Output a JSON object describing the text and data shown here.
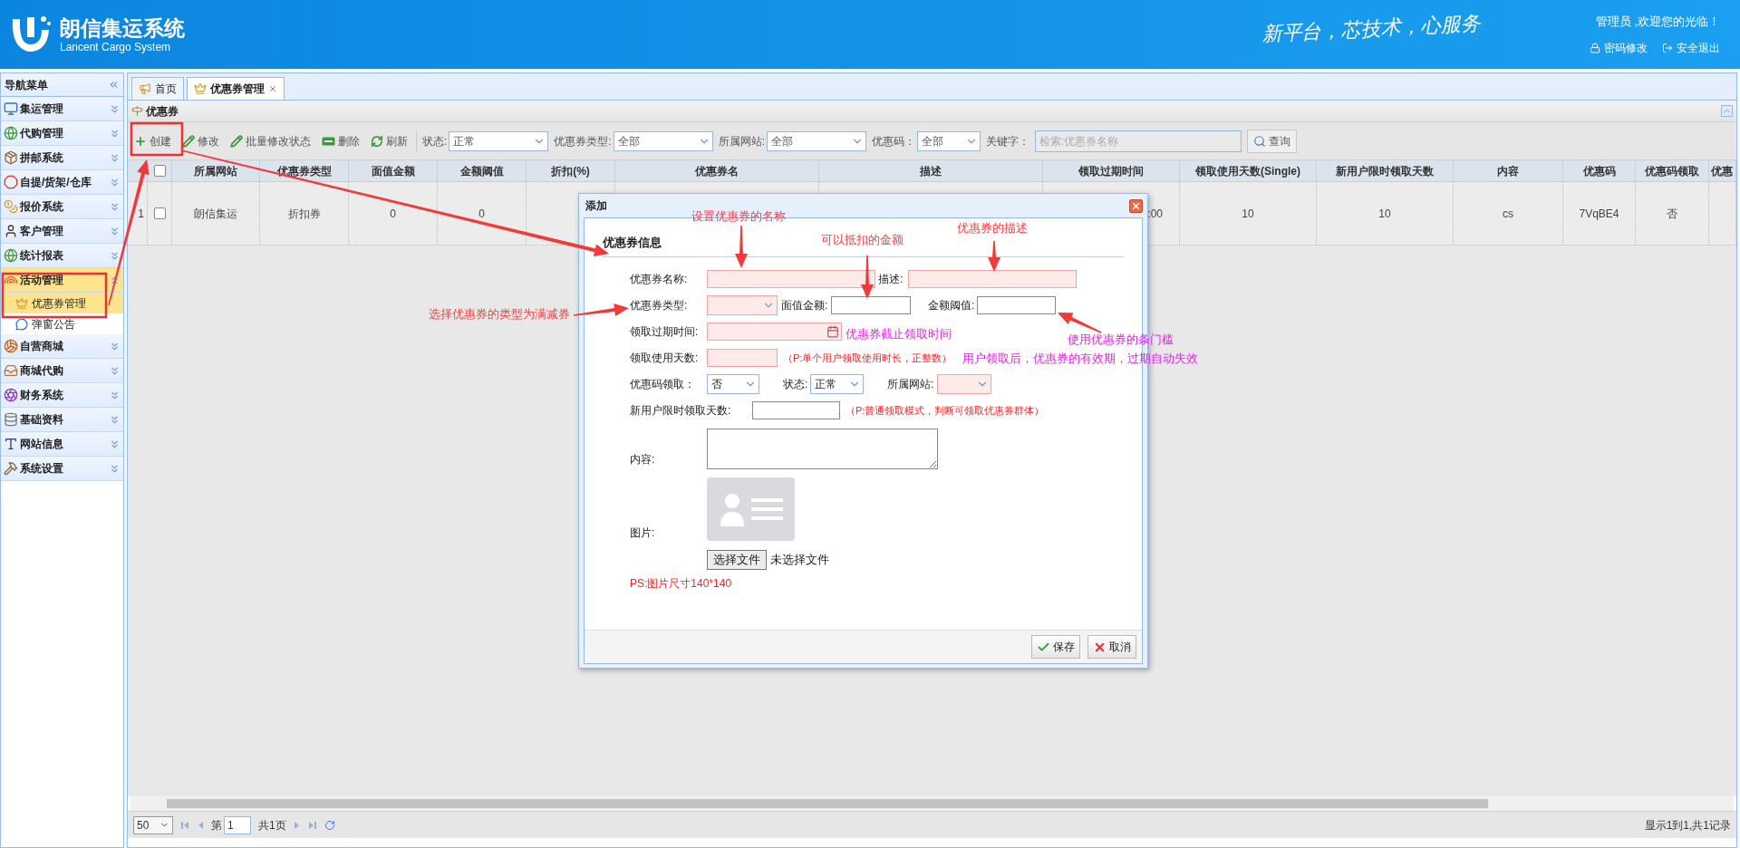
{
  "header": {
    "title": "朗信集运系统",
    "subtitle": "Lancent Cargo System",
    "slogan": "新平台，芯技术，心服务",
    "welcome": "管理员 ,欢迎您的光临！",
    "links": [
      "密码修改",
      "安全退出"
    ]
  },
  "sidebar": {
    "title": "导航菜单",
    "items": [
      {
        "label": "集运管理",
        "expanded": false
      },
      {
        "label": "代购管理",
        "expanded": false
      },
      {
        "label": "拼邮系统",
        "expanded": false
      },
      {
        "label": "自提/货架/仓库",
        "expanded": false
      },
      {
        "label": "报价系统",
        "expanded": false
      },
      {
        "label": "客户管理",
        "expanded": false
      },
      {
        "label": "统计报表",
        "expanded": false
      },
      {
        "label": "活动管理",
        "expanded": true,
        "children": [
          {
            "label": "优惠券管理",
            "selected": true
          },
          {
            "label": "弹窗公告",
            "selected": false
          }
        ]
      },
      {
        "label": "自营商城",
        "expanded": false
      },
      {
        "label": "商城代购",
        "expanded": false
      },
      {
        "label": "财务系统",
        "expanded": false
      },
      {
        "label": "基础资料",
        "expanded": false
      },
      {
        "label": "网站信息",
        "expanded": false
      },
      {
        "label": "系统设置",
        "expanded": false
      }
    ]
  },
  "tabs": [
    {
      "label": "首页",
      "selected": false,
      "closable": false
    },
    {
      "label": "优惠券管理",
      "selected": true,
      "closable": true
    }
  ],
  "panel_title": "优惠券",
  "toolbar": {
    "buttons": [
      "创建",
      "修改",
      "批量修改状态",
      "删除",
      "刷新"
    ],
    "filters": [
      {
        "label": "状态:",
        "value": "正常"
      },
      {
        "label": "优惠券类型:",
        "value": "全部"
      },
      {
        "label": "所属网站:",
        "value": "全部"
      },
      {
        "label": "优惠码：",
        "value": "全部"
      }
    ],
    "keyword": {
      "label": "关键字：",
      "placeholder": "检索:优惠券名称"
    },
    "search_button": "查询"
  },
  "table": {
    "header_checked": false,
    "columns": [
      "所属网站",
      "优惠券类型",
      "面值金额",
      "金额阈值",
      "折扣(%)",
      "优惠券名",
      "描述",
      "领取过期时间",
      "领取使用天数(Single)",
      "新用户限时领取天数",
      "内容",
      "优惠码",
      "优惠码领取",
      "优惠"
    ],
    "rows": [
      {
        "number": "1",
        "checked": false,
        "cells": [
          "朗信集运",
          "折扣券",
          "0",
          "0",
          null,
          null,
          null,
          ":00",
          "10",
          "10",
          "cs",
          "7VqBE4",
          "否",
          null
        ]
      }
    ]
  },
  "pager": {
    "page_size": "50",
    "page_label": "第",
    "page": "1",
    "total_pages": "共1页",
    "summary": "显示1到1,共1记录"
  },
  "dialog": {
    "title": "添加",
    "section": "优惠券信息",
    "rows": [
      {
        "fields": [
          {
            "kind": "text",
            "label": "优惠券名称:",
            "invalid": true
          },
          {
            "kind": "text",
            "label": "描述:",
            "invalid": true
          }
        ]
      },
      {
        "fields": [
          {
            "kind": "select",
            "label": "优惠券类型:",
            "invalid": true
          },
          {
            "kind": "text",
            "label": "面值金额:",
            "invalid": false
          },
          {
            "kind": "text",
            "label": "金额阈值:",
            "invalid": false
          }
        ]
      },
      {
        "fields": [
          {
            "kind": "date",
            "label": "领取过期时间:",
            "invalid": true
          }
        ]
      },
      {
        "fields": [
          {
            "kind": "text",
            "label": "领取使用天数:",
            "invalid": true,
            "hint": "（P:单个用户领取使用时长，正整数）"
          }
        ]
      },
      {
        "fields": [
          {
            "kind": "select",
            "label": "优惠码领取：",
            "value": "否",
            "invalid": false
          },
          {
            "kind": "select",
            "label": "状态:",
            "value": "正常",
            "invalid": false
          },
          {
            "kind": "select",
            "label": "所属网站:",
            "invalid": true
          }
        ]
      },
      {
        "fields": [
          {
            "kind": "text",
            "label": "新用户限时领取天数:",
            "invalid": false,
            "hint": "（P:普通领取模式，判断可领取优惠券群体）"
          }
        ]
      },
      {
        "fields": [
          {
            "kind": "textarea",
            "label": "内容:"
          }
        ]
      },
      {
        "fields": [
          {
            "kind": "image",
            "label": "图片:",
            "button": "选择文件",
            "file_status": "未选择文件",
            "note": "PS:图片尺寸140*140"
          }
        ]
      }
    ],
    "buttons": [
      "保存",
      "取消"
    ]
  },
  "annotations": [
    {
      "text": "设置优惠券的名称",
      "color": "#ff3b3b"
    },
    {
      "text": "可以抵扣的金额",
      "color": "#ff3b3b"
    },
    {
      "text": "优惠券的描述",
      "color": "#ff3b3b"
    },
    {
      "text": "选择优惠券的类型为满减券",
      "color": "#ff3b3b"
    },
    {
      "text": "优惠券截止领取时间",
      "color": "#e826e8"
    },
    {
      "text": "使用优惠券的条门槛",
      "color": "#e826e8"
    },
    {
      "text": "用户领取后，优惠券的有效期，过期自动失效",
      "color": "#e826e8"
    }
  ]
}
